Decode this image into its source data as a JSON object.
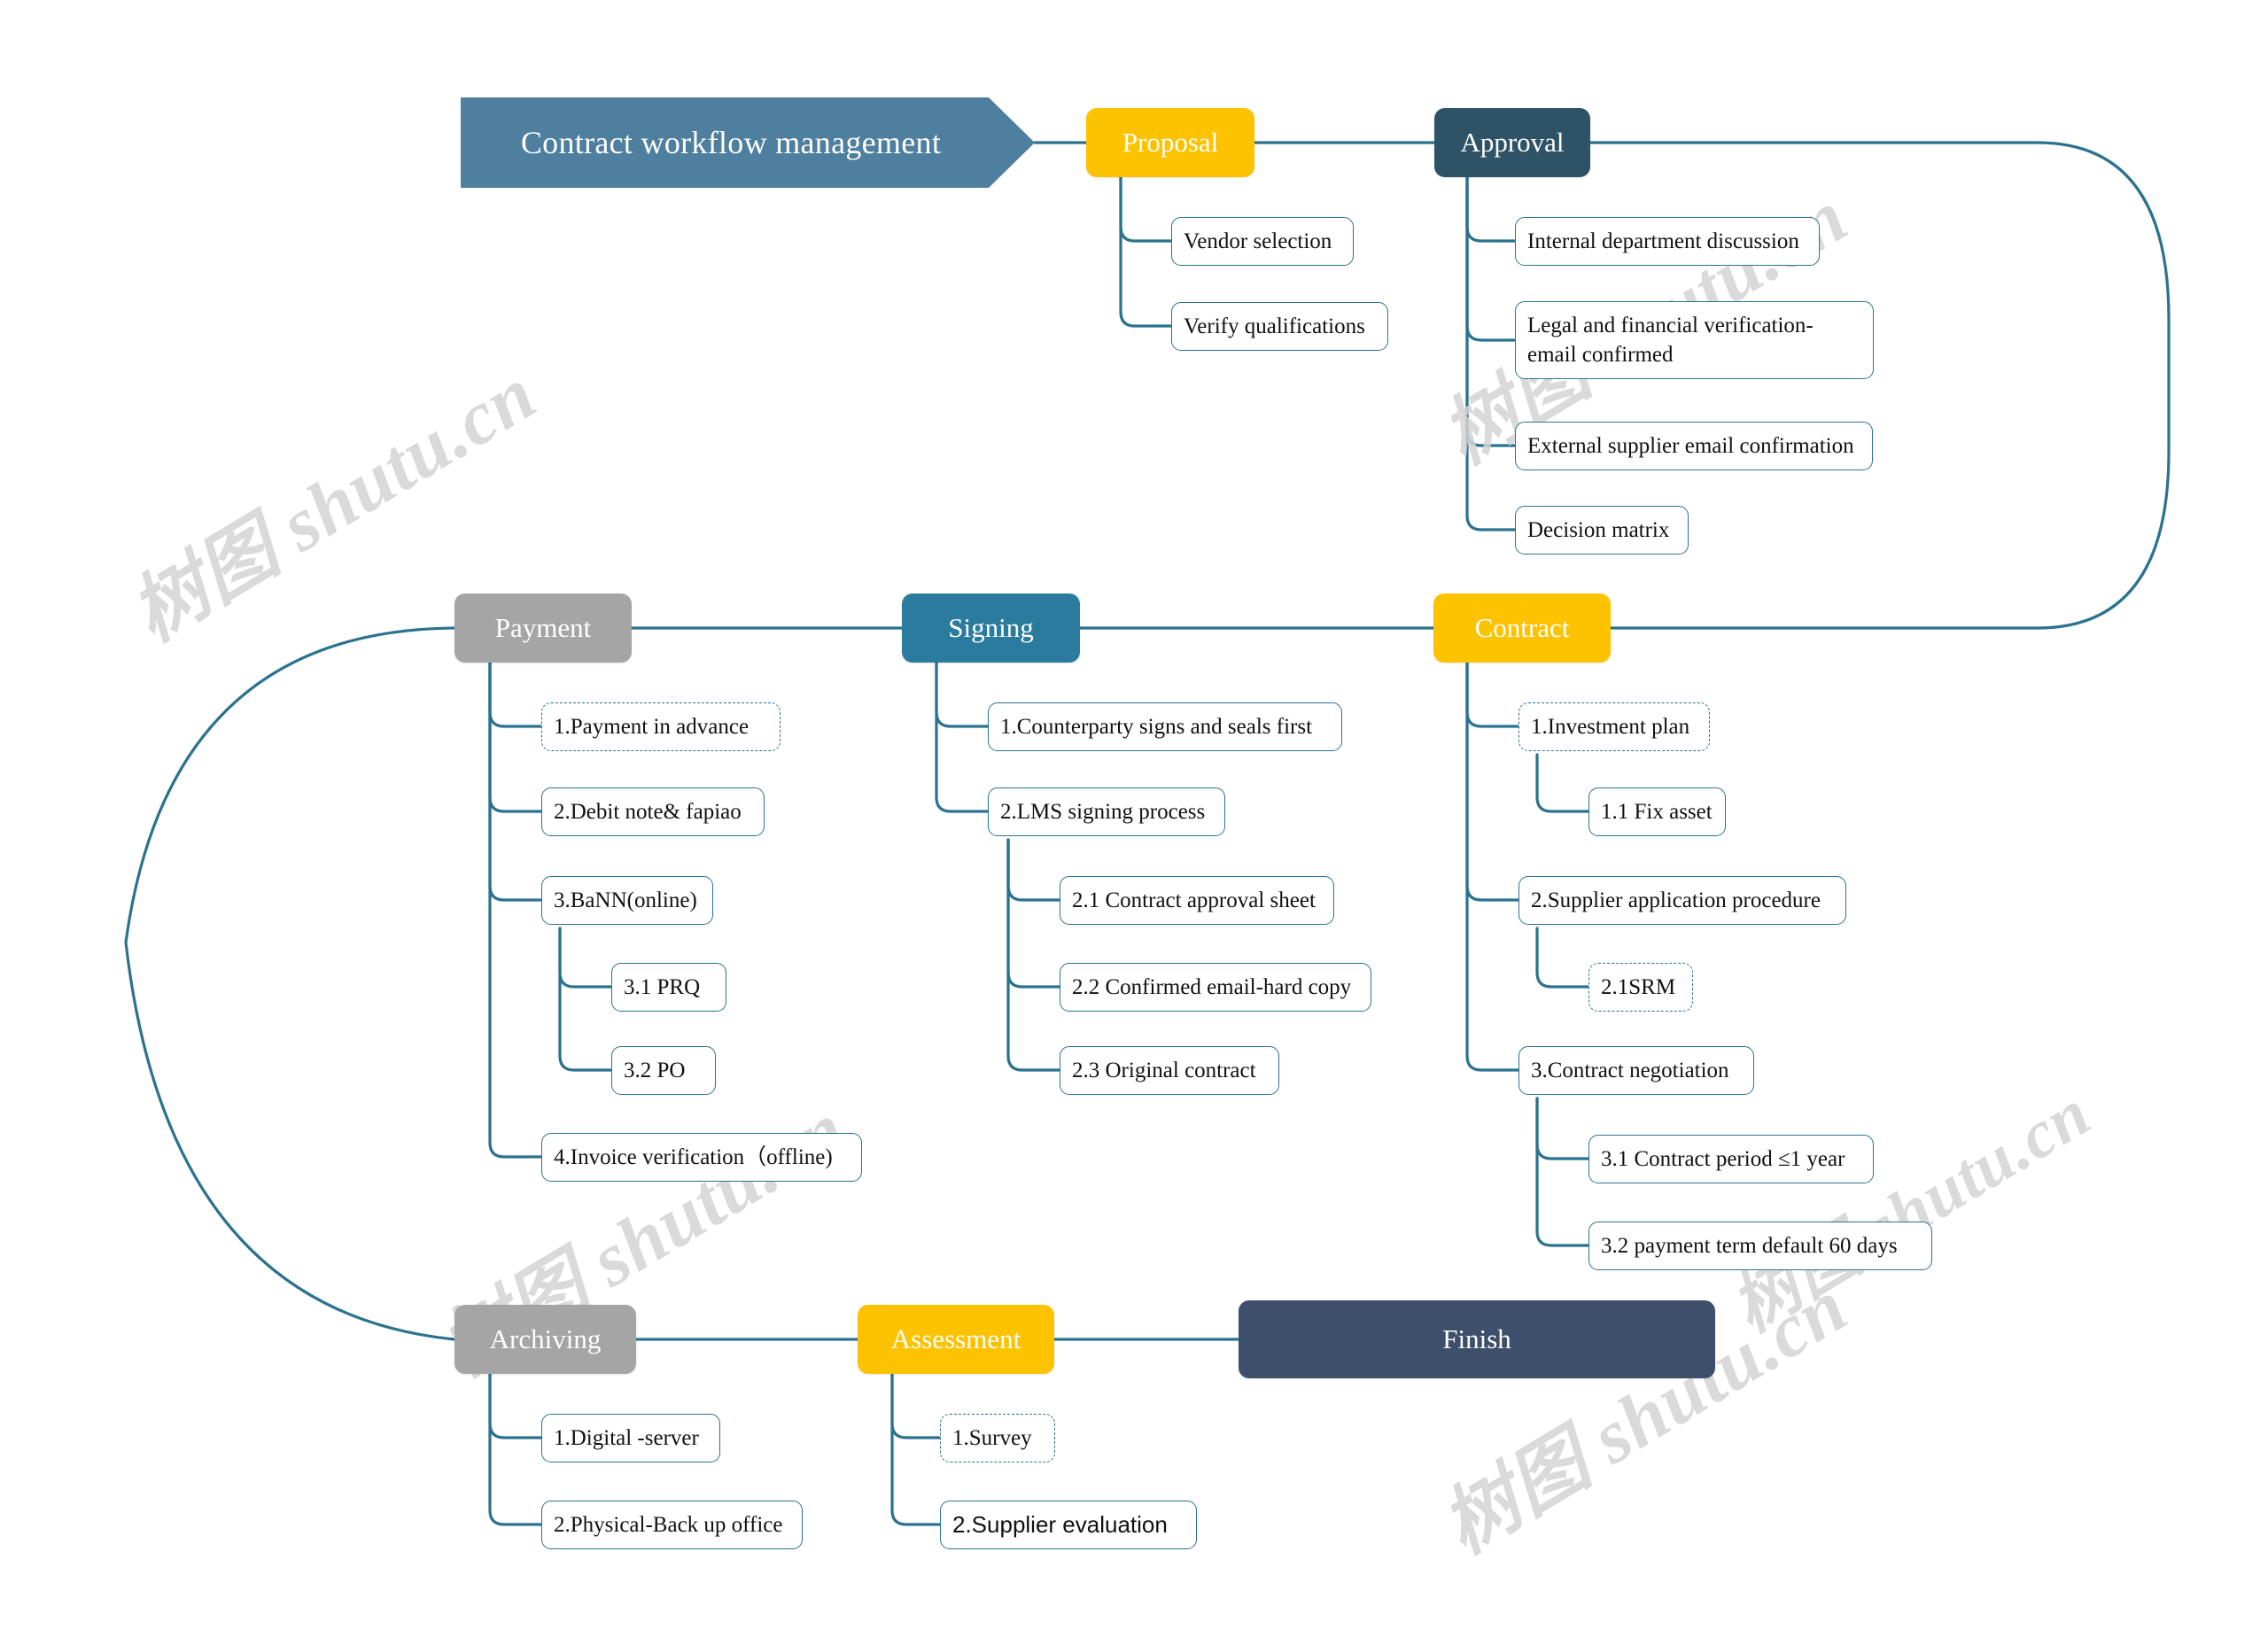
{
  "title": "Contract workflow management",
  "watermark": {
    "text": "树图 shutu.cn"
  },
  "colors": {
    "banner": "#4e7f9e",
    "yellow": "#fdc300",
    "dark_teal": "#2e5366",
    "teal": "#2a7b9d",
    "gray": "#a5a5a5",
    "navy": "#3d4f6b",
    "connector": "#2b728f",
    "leaf_border": "#2b728f",
    "leaf_fill": "#ffffff"
  },
  "stages": {
    "proposal": "Proposal",
    "approval": "Approval",
    "contract": "Contract",
    "signing": "Signing",
    "payment": "Payment",
    "archiving": "Archiving",
    "assessment": "Assessment",
    "finish": "Finish"
  },
  "proposal_items": [
    "Vendor selection",
    "Verify qualifications"
  ],
  "approval_items": [
    "Internal department discussion",
    "Legal and financial verification-email confirmed",
    "External supplier email confirmation",
    "Decision matrix"
  ],
  "contract_items": {
    "i1": "1.Investment plan",
    "i1_1": "1.1 Fix asset",
    "i2": "2.Supplier application procedure",
    "i2_1": "2.1SRM",
    "i3": "3.Contract negotiation",
    "i3_1": "3.1 Contract period ≤1 year",
    "i3_2": "3.2 payment term default 60 days"
  },
  "signing_items": {
    "i1": "1.Counterparty signs and seals first",
    "i2": "2.LMS signing process",
    "i2_1": "2.1 Contract approval sheet",
    "i2_2": "2.2 Confirmed email-hard copy",
    "i2_3": "2.3 Original contract"
  },
  "payment_items": {
    "i1": "1.Payment in advance",
    "i2": "2.Debit note& fapiao",
    "i3": "3.BaNN(online)",
    "i3_1": "3.1 PRQ",
    "i3_2": "3.2 PO",
    "i4": "4.Invoice verification（offline)"
  },
  "archiving_items": [
    "1.Digital -server",
    "2.Physical-Back up office"
  ],
  "assessment_items": {
    "i1": "1.Survey",
    "i2": "2.Supplier evaluation"
  }
}
